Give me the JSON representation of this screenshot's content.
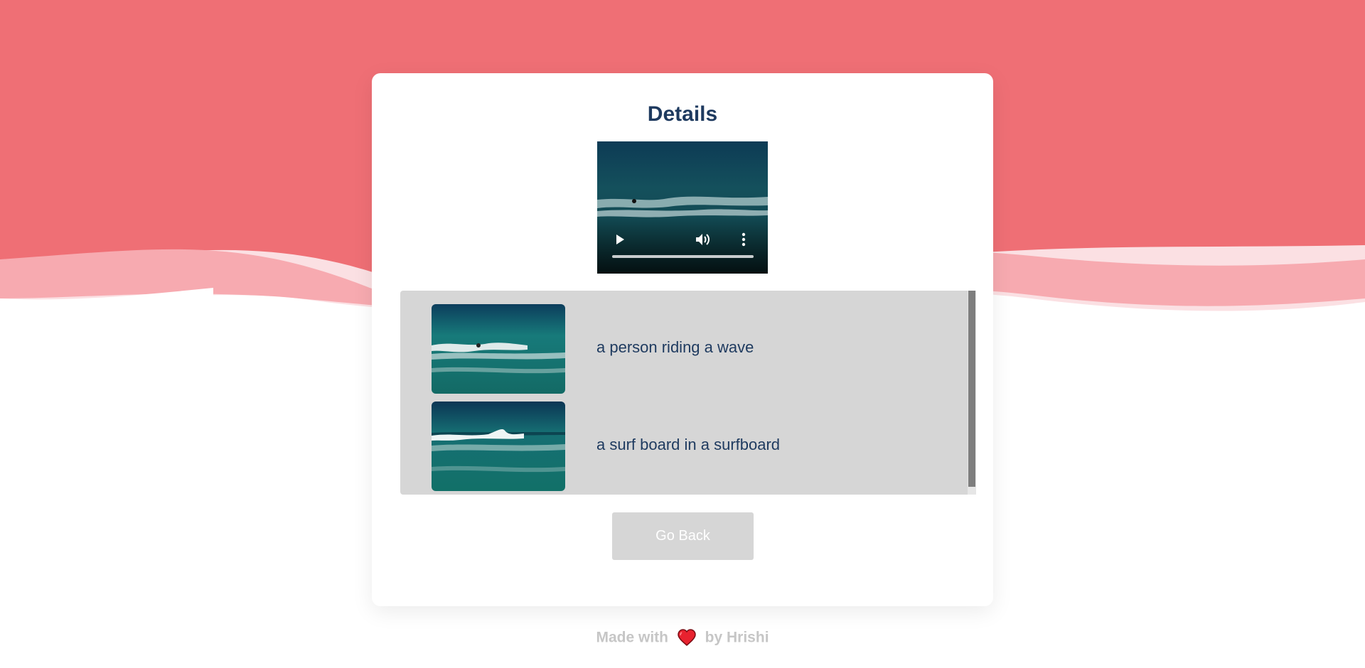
{
  "colors": {
    "hero_background": "#ef6f75",
    "wave_light": "#f7aab0",
    "wave_pale": "#fbe0e3",
    "title_text": "#1e3a5f",
    "list_background": "#d6d6d6",
    "button_background": "#d6d6d6",
    "footer_text": "#c6c6c6",
    "heart": "#e8222f"
  },
  "card": {
    "title": "Details"
  },
  "video": {
    "play_icon": "play-icon",
    "volume_icon": "volume-icon",
    "more_icon": "more-vertical-icon",
    "progress": 0
  },
  "results": [
    {
      "caption": "a person riding a wave"
    },
    {
      "caption": "a surf board in a surfboard"
    }
  ],
  "buttons": {
    "go_back": "Go Back"
  },
  "footer": {
    "made_with": "Made with",
    "heart_icon": "heart-icon",
    "by": "by Hrishi"
  }
}
